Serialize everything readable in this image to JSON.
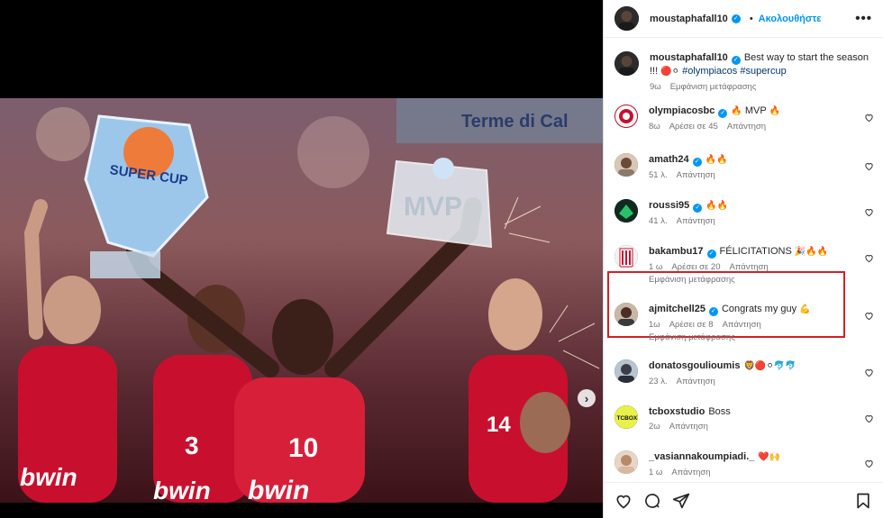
{
  "post": {
    "username": "moustaphafall10",
    "follow_label": "Ακολουθήστε",
    "more_label": "•••",
    "caption_user": "moustaphafall10",
    "caption_text": "Best way to start the season !!!",
    "caption_emoji": "🔴⚪",
    "caption_tags": "#olympiacos #supercup",
    "caption_time": "9ω",
    "caption_translate": "Εμφάνιση μετάφρασης"
  },
  "photo": {
    "banner_text": "Terme di Cal",
    "trophy_text": "SUPER CUP",
    "mvp_text": "MVP",
    "jersey_left": "3",
    "jersey_center": "10",
    "jersey_right": "14",
    "sponsor": "bwin",
    "next_label": "›"
  },
  "comments": [
    {
      "user": "olympiacosbc",
      "text": "MVP",
      "emoji_before": "🔥",
      "emoji_after": "🔥",
      "time": "8ω",
      "likes": "Αρέσει σε 45",
      "reply": "Απάντηση",
      "translate": ""
    },
    {
      "user": "amath24",
      "text": "",
      "emoji_before": "",
      "emoji_after": "🔥🔥",
      "time": "51 λ.",
      "likes": "",
      "reply": "Απάντηση",
      "translate": ""
    },
    {
      "user": "roussi95",
      "text": "",
      "emoji_before": "",
      "emoji_after": "🔥🔥",
      "time": "41 λ.",
      "likes": "",
      "reply": "Απάντηση",
      "translate": ""
    },
    {
      "user": "bakambu17",
      "text": "FÉLICITATIONS",
      "emoji_before": "",
      "emoji_after": "🎉🔥🔥",
      "time": "1 ω",
      "likes": "Αρέσει σε 20",
      "reply": "Απάντηση",
      "translate": "Εμφάνιση μετάφρασης"
    },
    {
      "user": "ajmitchell25",
      "text": "Congrats my guy",
      "emoji_before": "",
      "emoji_after": "💪",
      "time": "1ω",
      "likes": "Αρέσει σε 8",
      "reply": "Απάντηση",
      "translate": "Εμφάνιση μετάφρασης"
    },
    {
      "user": "donatosgoulioumis",
      "text": "",
      "emoji_before": "",
      "emoji_after": "🦁🔴⚪🐬🐬",
      "time": "23 λ.",
      "likes": "",
      "reply": "Απάντηση",
      "translate": ""
    },
    {
      "user": "tcboxstudio",
      "text": "Boss",
      "emoji_before": "",
      "emoji_after": "",
      "time": "2ω",
      "likes": "",
      "reply": "Απάντηση",
      "translate": ""
    },
    {
      "user": "_vasiannakoumpiadi._",
      "text": "",
      "emoji_before": "",
      "emoji_after": "❤️🙌",
      "time": "1 ω",
      "likes": "",
      "reply": "Απάντηση",
      "translate": ""
    }
  ],
  "avatars": {
    "tcbox_label": "TCBOX"
  },
  "colors": {
    "accent": "#0095f6",
    "highlight": "#d32027",
    "olympiacos_red": "#c8102e"
  },
  "icons": [
    "heart-icon",
    "comment-icon",
    "share-icon",
    "bookmark-icon",
    "verified-icon",
    "more-icon"
  ]
}
